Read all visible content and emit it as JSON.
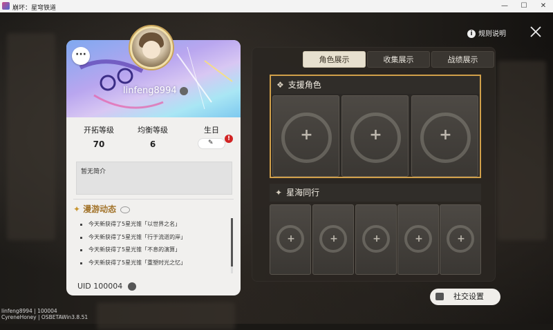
{
  "window": {
    "title": "崩坏：星穹铁道",
    "minimize": "—",
    "maximize": "☐",
    "close": "✕"
  },
  "header": {
    "rules_label": "规则说明",
    "info_icon": "i"
  },
  "profile": {
    "more": "···",
    "name": "linfeng8994",
    "stats": [
      {
        "label": "开拓等级",
        "value": "70"
      },
      {
        "label": "均衡等级",
        "value": "6"
      },
      {
        "label": "生日",
        "value": ""
      }
    ],
    "birthday_badge": "!",
    "bio": "暂无简介",
    "roaming_title": "漫游动态",
    "roaming_items": [
      "今天新获得了5星光锥「以世界之名」",
      "今天新获得了5星光锥「行于流逝的岸」",
      "今天新获得了5星光锥「不息的演算」",
      "今天新获得了5星光锥「重塑时光之忆」"
    ],
    "uid": "UID 100004"
  },
  "tabs": [
    {
      "label": "角色展示",
      "active": true
    },
    {
      "label": "收集展示",
      "active": false
    },
    {
      "label": "战绩展示",
      "active": false
    }
  ],
  "support_section": {
    "title": "支援角色",
    "plus": "+"
  },
  "voyage_section": {
    "title": "星海同行",
    "plus": "+"
  },
  "social_button": "社交设置",
  "footer": {
    "line1": "linfeng8994 | 100004",
    "line2": "CyreneHoney | OSBETAWin3.8.51"
  },
  "colors": {
    "accent_gold": "#d1a04a",
    "tab_active": "#e7e0cf",
    "badge_red": "#d12424"
  }
}
